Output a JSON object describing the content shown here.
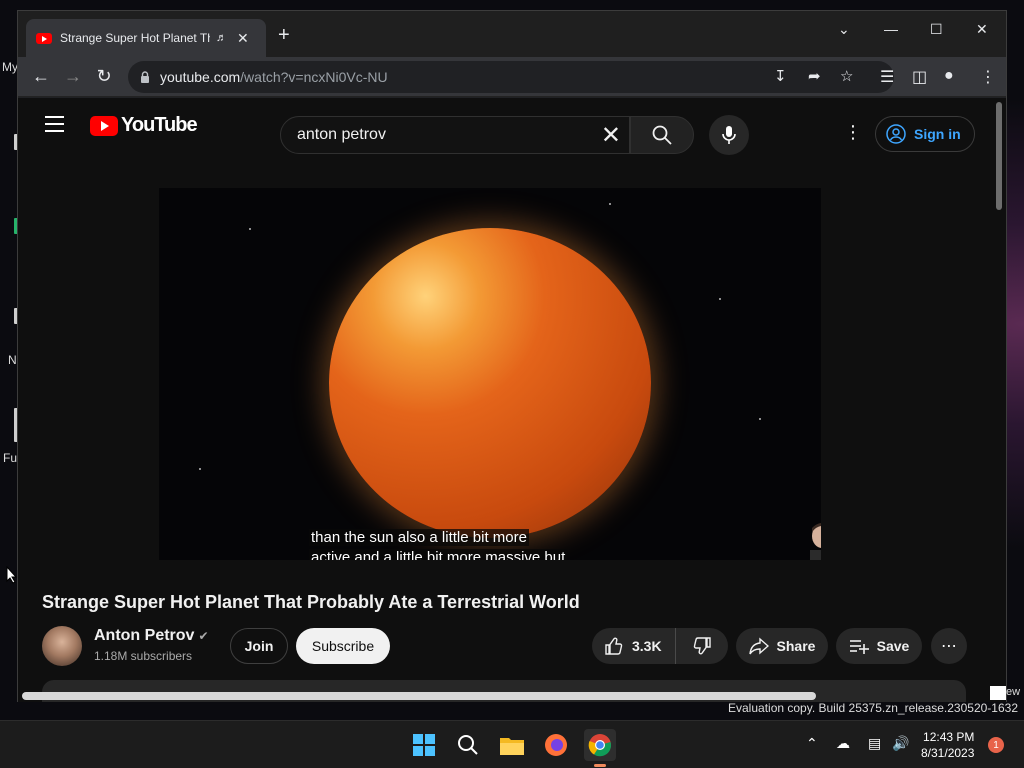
{
  "desktop": {
    "labels": [
      "My",
      "N",
      "Fu"
    ]
  },
  "browser": {
    "tab": {
      "title": "Strange Super Hot Planet That Probably Ate a Terrestrial World",
      "audio_icon": "speaker-icon",
      "close_glyph": "✕"
    },
    "new_tab_glyph": "+",
    "window": {
      "chevron": "⌄",
      "minimize": "—",
      "maximize": "☐",
      "close": "✕"
    },
    "nav": {
      "back": "←",
      "forward": "→",
      "reload": "↻"
    },
    "omnibox": {
      "host": "youtube.com",
      "path": "/watch?v=ncxNi0Vc-NU"
    }
  },
  "youtube": {
    "logo_text": "YouTube",
    "search": {
      "query": "anton petrov"
    },
    "sign_in_label": "Sign in",
    "caption_lines": [
      "than the sun also a little bit more",
      "active and a little bit more massive but"
    ],
    "video": {
      "title": "Strange Super Hot Planet That Probably Ate a Terrestrial World",
      "channel": "Anton Petrov",
      "subscribers": "1.18M subscribers",
      "join_label": "Join",
      "subscribe_label": "Subscribe",
      "likes": "3.3K",
      "share_label": "Share",
      "save_label": "Save"
    }
  },
  "watermark": {
    "text": "Evaluation copy. Build 25375.zn_release.230520-1632",
    "ew": "ew"
  },
  "taskbar": {
    "time": "12:43 PM",
    "date": "8/31/2023",
    "notifications": "1"
  },
  "colors": {
    "accent_link": "#3ea6ff",
    "youtube_red": "#ff0000",
    "page_bg": "#0f0f0f"
  }
}
